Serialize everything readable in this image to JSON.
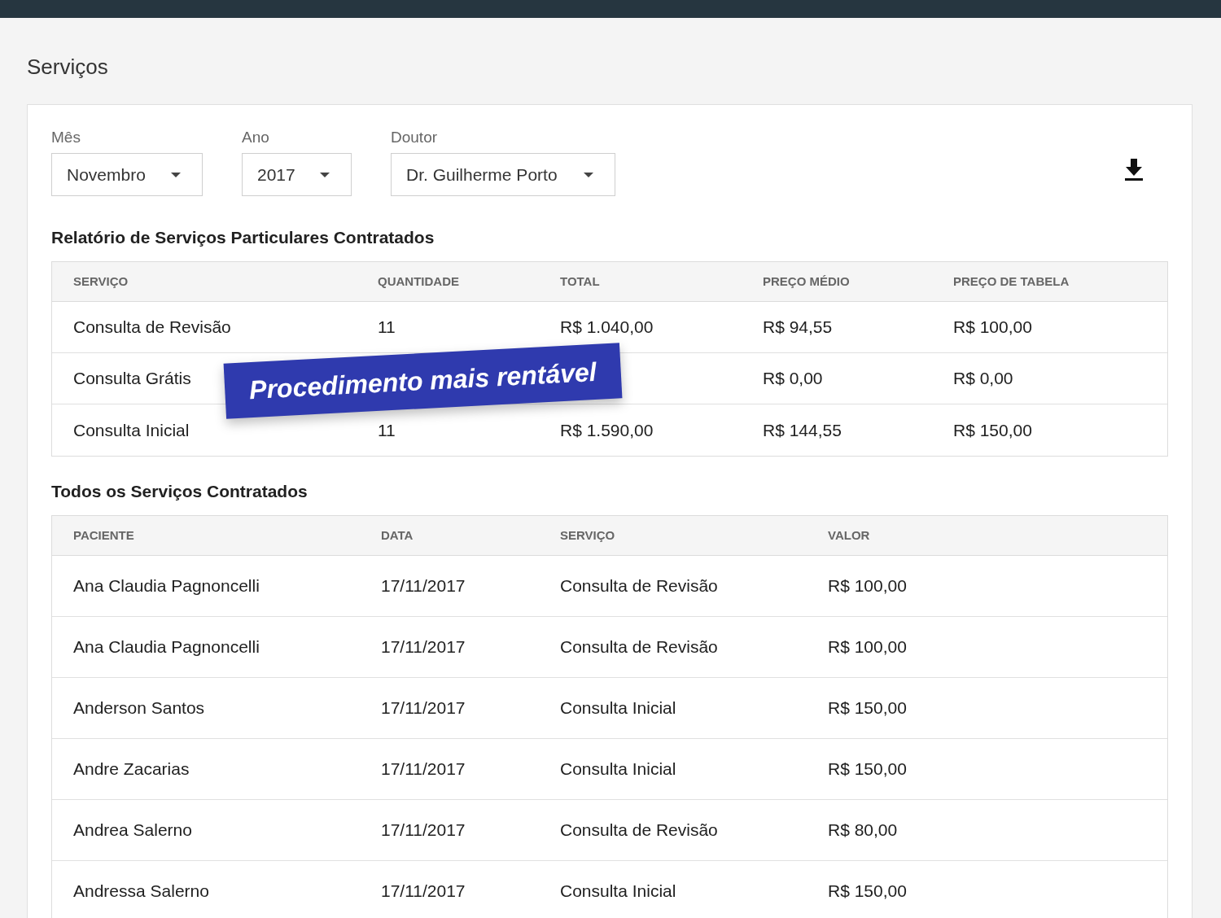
{
  "page_title": "Serviços",
  "filters": [
    {
      "label": "Mês",
      "value": "Novembro"
    },
    {
      "label": "Ano",
      "value": "2017"
    },
    {
      "label": "Doutor",
      "value": "Dr. Guilherme Porto"
    }
  ],
  "report_table": {
    "title": "Relatório de Serviços Particulares Contratados",
    "columns": [
      "SERVIÇO",
      "QUANTIDADE",
      "TOTAL",
      "PREÇO MÉDIO",
      "PREÇO DE TABELA"
    ],
    "rows": [
      [
        "Consulta de Revisão",
        "11",
        "R$ 1.040,00",
        "R$ 94,55",
        "R$ 100,00"
      ],
      [
        "Consulta Grátis",
        null,
        null,
        "R$ 0,00",
        "R$ 0,00"
      ],
      [
        "Consulta Inicial",
        "11",
        "R$ 1.590,00",
        "R$ 144,55",
        "R$ 150,00"
      ]
    ]
  },
  "banner": {
    "text": "Procedimento mais rentável"
  },
  "all_table": {
    "title": "Todos os Serviços Contratados",
    "columns": [
      "PACIENTE",
      "DATA",
      "SERVIÇO",
      "VALOR"
    ],
    "rows": [
      [
        "Ana Claudia Pagnoncelli",
        "17/11/2017",
        "Consulta de Revisão",
        "R$ 100,00"
      ],
      [
        "Ana Claudia Pagnoncelli",
        "17/11/2017",
        "Consulta de Revisão",
        "R$ 100,00"
      ],
      [
        "Anderson Santos",
        "17/11/2017",
        "Consulta Inicial",
        "R$ 150,00"
      ],
      [
        "Andre Zacarias",
        "17/11/2017",
        "Consulta Inicial",
        "R$ 150,00"
      ],
      [
        "Andrea Salerno",
        "17/11/2017",
        "Consulta de Revisão",
        "R$ 80,00"
      ],
      [
        "Andressa Salerno",
        "17/11/2017",
        "Consulta Inicial",
        "R$ 150,00"
      ]
    ]
  }
}
